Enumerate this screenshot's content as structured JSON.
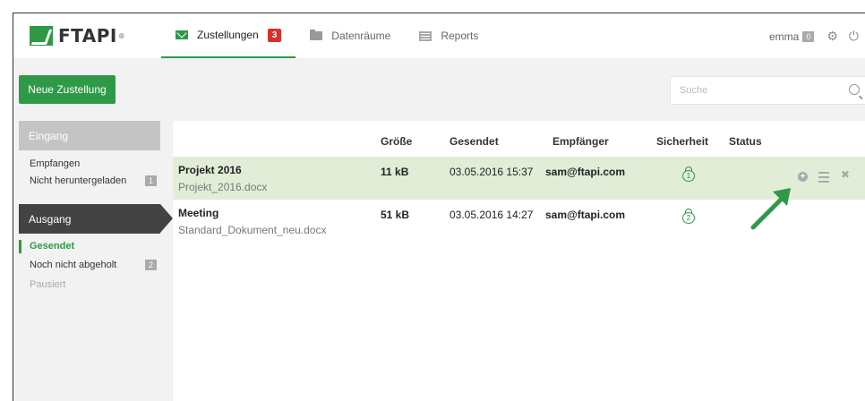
{
  "header": {
    "logo": "FTAPI",
    "logo_mark": "®",
    "tabs": [
      {
        "label": "Zustellungen",
        "icon": "envelope-icon",
        "badge": "3"
      },
      {
        "label": "Datenräume",
        "icon": "folder-icon"
      },
      {
        "label": "Reports",
        "icon": "report-icon"
      }
    ],
    "user": "emma",
    "user_badge": "0"
  },
  "toolbar": {
    "new_label": "Neue Zustellung",
    "search_placeholder": "Suche"
  },
  "sidebar": {
    "inbox_title": "Eingang",
    "inbox_items": [
      {
        "label": "Empfangen"
      },
      {
        "label": "Nicht heruntergeladen",
        "count": "1"
      }
    ],
    "outbox_title": "Ausgang",
    "outbox_items": [
      {
        "label": "Gesendet"
      },
      {
        "label": "Noch nicht abgeholt",
        "count": "2"
      },
      {
        "label": "Pausiert"
      }
    ]
  },
  "table": {
    "columns": [
      "Größe",
      "Gesendet",
      "Empfänger",
      "Sicherheit",
      "Status"
    ],
    "rows": [
      {
        "title": "Projekt 2016",
        "file": "Projekt_2016.docx",
        "size": "11 kB",
        "sent": "03.05.2016 15:37",
        "recipient": "sam@ftapi.com",
        "security": "1"
      },
      {
        "title": "Meeting",
        "file": "Standard_Dokument_neu.docx",
        "size": "51 kB",
        "sent": "03.05.2016 14:27",
        "recipient": "sam@ftapi.com",
        "security": "2"
      }
    ]
  },
  "colors": {
    "brand": "#2e9a47",
    "alert": "#d9302b",
    "row_highlight": "#e2edd8",
    "sidebar_dark": "#434343"
  }
}
